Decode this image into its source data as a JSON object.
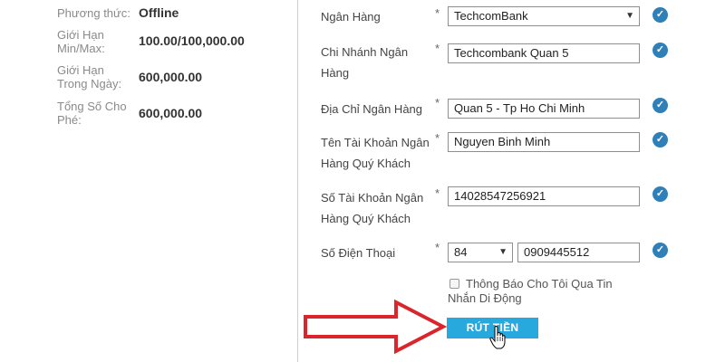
{
  "summary": {
    "method_label": "Phương thức:",
    "method_value": "Offline",
    "minmax_label": "Giới Hạn Min/Max:",
    "minmax_value": "100.00/100,000.00",
    "daily_label": "Giới Hạn Trong Ngày:",
    "daily_value": "600,000.00",
    "fee_label": "Tổng Số Cho Phé:",
    "fee_value": "600,000.00"
  },
  "form": {
    "required_mark": "*",
    "bank_label": "Ngân Hàng",
    "bank_value": "TechcomBank",
    "branch_label": "Chi Nhánh Ngân Hàng",
    "branch_value": "Techcombank Quan 5",
    "address_label": "Địa Chỉ Ngân Hàng",
    "address_value": "Quan 5 - Tp Ho Chi Minh",
    "account_name_label": "Tên Tài Khoản Ngân Hàng Quý Khách",
    "account_name_value": "Nguyen Binh Minh",
    "account_number_label": "Số Tài Khoản Ngân Hàng Quý Khách",
    "account_number_value": "14028547256921",
    "phone_label": "Số Điện Thoại",
    "phone_code_value": "84",
    "phone_value": "0909445512",
    "sms_label": "Thông Báo Cho Tôi Qua Tin Nhắn Di Động",
    "submit_label": "RÚT TIỀN"
  },
  "icons": {
    "valid": "check-circle-icon",
    "dropdown": "chevron-down-icon",
    "pointer": "hand-cursor-icon",
    "annotation": "red-arrow-icon"
  },
  "colors": {
    "accent": "#28a9de",
    "check": "#2f7fb8",
    "annotation_arrow": "#d9262c"
  }
}
